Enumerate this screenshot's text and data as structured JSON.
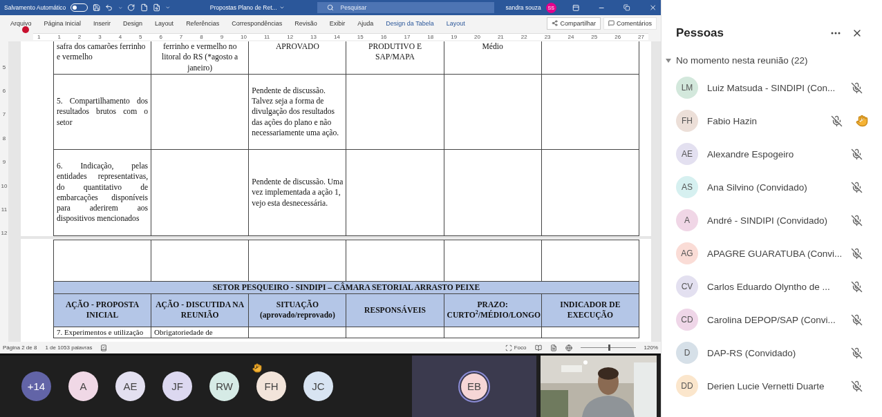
{
  "title_bar": {
    "autosave_label": "Salvamento Automático",
    "autosave_on": false,
    "document_title": "Propostas Plano de Ret...",
    "search": {
      "placeholder": "Pesquisar"
    },
    "user_name": "sandra souza",
    "user_initials": "SS"
  },
  "ribbon": {
    "tabs": [
      {
        "label": "Arquivo",
        "contextual": false
      },
      {
        "label": "Página Inicial",
        "contextual": false
      },
      {
        "label": "Inserir",
        "contextual": false
      },
      {
        "label": "Design",
        "contextual": false
      },
      {
        "label": "Layout",
        "contextual": false
      },
      {
        "label": "Referências",
        "contextual": false
      },
      {
        "label": "Correspondências",
        "contextual": false
      },
      {
        "label": "Revisão",
        "contextual": false
      },
      {
        "label": "Exibir",
        "contextual": false
      },
      {
        "label": "Ajuda",
        "contextual": false
      },
      {
        "label": "Design da Tabela",
        "contextual": true
      },
      {
        "label": "Layout",
        "contextual": true
      }
    ],
    "share_label": "Compartilhar",
    "comments_label": "Comentários"
  },
  "ruler": {
    "marks": [
      "1",
      "1",
      "2",
      "3",
      "4",
      "5",
      "6",
      "7",
      "8",
      "9",
      "10",
      "11",
      "12",
      "13",
      "14",
      "15",
      "16",
      "17",
      "18",
      "19",
      "20",
      "21",
      "22",
      "23",
      "24",
      "25",
      "26",
      "27"
    ],
    "vertical_marks": [
      "5",
      "6",
      "7",
      "8",
      "9",
      "10",
      "11",
      "12"
    ]
  },
  "document": {
    "table_rows": [
      [
        "safra dos camarões ferrinho e vermelho",
        "ferrinho e vermelho no litoral do RS (*agosto a janeiro)",
        "APROVADO",
        "PRODUTIVO E SAP/MAPA",
        "Médio",
        null
      ],
      [
        "5. Compartilhamento dos resultados brutos com o setor",
        null,
        "Pendente de discussão. Talvez seja a forma de divulgação dos resultados das ações do plano e não necessariamente uma ação.",
        null,
        null,
        null
      ],
      [
        "6. Indicação, pelas entidades representativas, do quantitativo de embarcações disponíveis para aderirem aos dispositivos mencionados",
        null,
        "Pendente de discussão. Uma vez implementada a ação 1, vejo esta desnecessária.",
        null,
        null,
        null
      ]
    ],
    "next_table": {
      "section_title": "SETOR PESQUEIRO - SINDIPI – CÂMARA SETORIAL ARRASTO PEIXE",
      "headers": [
        "AÇÃO - PROPOSTA INICIAL",
        "AÇÃO - DISCUTIDA NA REUNIÃO",
        "SITUAÇÃO (aprovado/reprovado)",
        "RESPONSÁVEIS",
        "PRAZO: CURTO$^{2}$/MÉDIO/LONGO",
        "INDICADOR DE EXECUÇÃO"
      ],
      "partial_row": [
        "7. Experimentos e utilização",
        "Obrigatoriedade de"
      ]
    }
  },
  "status_bar": {
    "page": "Página 2 de 8",
    "words": "1 de 1053 palavras",
    "focus_label": "Foco",
    "zoom": {
      "level": 0.5
    },
    "zoom_label": "120%"
  },
  "video_strip": {
    "participants": [
      {
        "initials": "+14",
        "color": "#6264a7",
        "hand_raised": false
      },
      {
        "initials": "A",
        "color": "#f0d8e6",
        "hand_raised": false
      },
      {
        "initials": "AE",
        "color": "#e3e0f0",
        "hand_raised": false
      },
      {
        "initials": "JF",
        "color": "#dcd8f0",
        "hand_raised": false
      },
      {
        "initials": "RW",
        "color": "#d6ebe6",
        "hand_raised": false
      },
      {
        "initials": "FH",
        "color": "#f2e4da",
        "hand_raised": true
      },
      {
        "initials": "JC",
        "color": "#d8e4f2",
        "hand_raised": false
      }
    ],
    "speaker": {
      "initials": "EB",
      "color": "#f6d6d6"
    }
  },
  "people_panel": {
    "title": "Pessoas",
    "section": {
      "label": "No momento nesta reunião (22)",
      "expanded": true
    },
    "people": [
      {
        "initials": "LM",
        "name": "Luiz Matsuda - SINDIPI (Con...",
        "color": "#d3e8dc",
        "muted": true,
        "hand_raised": false
      },
      {
        "initials": "FH",
        "name": "Fabio Hazin",
        "color": "#ecdfd8",
        "muted": true,
        "hand_raised": true
      },
      {
        "initials": "AE",
        "name": "Alexandre Espogeiro",
        "color": "#e3e0f0",
        "muted": true,
        "hand_raised": false
      },
      {
        "initials": "AS",
        "name": "Ana Silvino (Convidado)",
        "color": "#d6f0f0",
        "muted": true,
        "hand_raised": false
      },
      {
        "initials": "A",
        "name": "André - SINDIPI (Convidado)",
        "color": "#f0d6e6",
        "muted": true,
        "hand_raised": false
      },
      {
        "initials": "AG",
        "name": "APAGRE GUARATUBA (Convi...",
        "color": "#fadcd6",
        "muted": true,
        "hand_raised": false
      },
      {
        "initials": "CV",
        "name": "Carlos Eduardo Olyntho de ...",
        "color": "#e3e0f0",
        "muted": true,
        "hand_raised": false
      },
      {
        "initials": "CD",
        "name": "Carolina DEPOP/SAP (Convi...",
        "color": "#efd6e8",
        "muted": true,
        "hand_raised": false
      },
      {
        "initials": "D",
        "name": "DAP-RS (Convidado)",
        "color": "#d6e0e8",
        "muted": true,
        "hand_raised": false
      },
      {
        "initials": "DD",
        "name": "Derien Lucie Vernetti Duarte",
        "color": "#fbe6cc",
        "muted": true,
        "hand_raised": false
      }
    ]
  }
}
